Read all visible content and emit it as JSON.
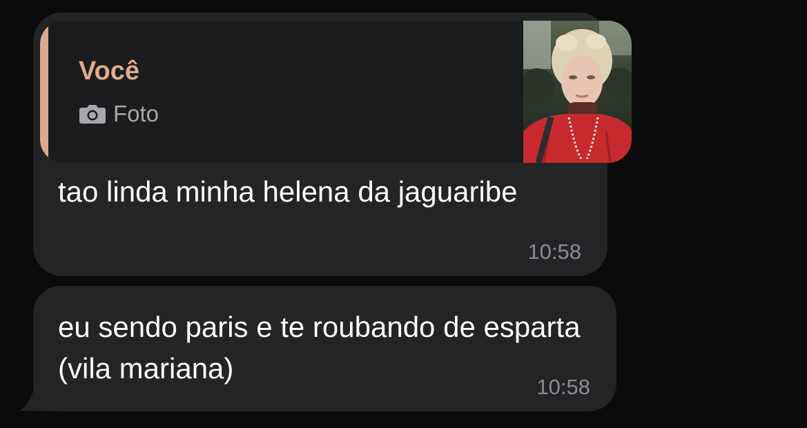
{
  "messages": [
    {
      "reply": {
        "author": "Você",
        "media_label": "Foto",
        "media_icon": "camera-icon",
        "author_color": "#e0ab8d",
        "bar_color": "#d9a98c"
      },
      "text": "tao linda minha helena da jaguaribe",
      "time": "10:58"
    },
    {
      "text": "eu sendo paris e te roubando de esparta (vila mariana)",
      "time": "10:58"
    }
  ],
  "colors": {
    "background": "#0b0b0b",
    "bubble": "#232426",
    "quote_background": "#1b1c1d",
    "timestamp": "#8b8c90"
  }
}
